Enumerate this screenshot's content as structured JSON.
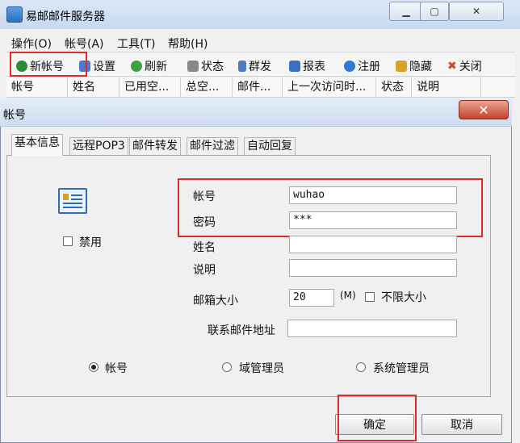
{
  "app": {
    "title": "易邮邮件服务器"
  },
  "menu": [
    "操作(O)",
    "帐号(A)",
    "工具(T)",
    "帮助(H)"
  ],
  "toolbar": [
    {
      "label": "新帐号",
      "icon": "new-account-icon",
      "color": "#2c8a3c"
    },
    {
      "label": "设置",
      "icon": "settings-icon",
      "color": "#4a7bd0"
    },
    {
      "label": "刷新",
      "icon": "refresh-icon",
      "color": "#3fa043"
    },
    {
      "label": "状态",
      "icon": "status-icon",
      "color": "#777777"
    },
    {
      "label": "群发",
      "icon": "broadcast-icon",
      "color": "#4d7ac0"
    },
    {
      "label": "报表",
      "icon": "report-icon",
      "color": "#3a6fc1"
    },
    {
      "label": "注册",
      "icon": "info-icon",
      "color": "#2e78d6"
    },
    {
      "label": "隐藏",
      "icon": "hide-icon",
      "color": "#d9a12a"
    },
    {
      "label": "关闭",
      "icon": "close-icon",
      "color": "#d6452c"
    }
  ],
  "columns": [
    "帐号",
    "姓名",
    "已用空...",
    "总空...",
    "邮件...",
    "上一次访问时...",
    "状态",
    "说明"
  ],
  "dialog": {
    "title": "帐号",
    "tabs": [
      "基本信息",
      "远程POP3",
      "邮件转发",
      "邮件过滤",
      "自动回复"
    ],
    "disable_label": "禁用",
    "fields": {
      "account": {
        "label": "帐号",
        "value": "wuhao"
      },
      "password": {
        "label": "密码",
        "value": "***"
      },
      "name": {
        "label": "姓名",
        "value": ""
      },
      "desc": {
        "label": "说明",
        "value": ""
      },
      "mailbox_size": {
        "label": "邮箱大小",
        "value": "20",
        "unit": "(M)"
      },
      "unlimited": {
        "label": "不限大小"
      },
      "contact": {
        "label": "联系邮件地址",
        "value": ""
      }
    },
    "roles": [
      {
        "label": "帐号",
        "selected": true
      },
      {
        "label": "域管理员",
        "selected": false
      },
      {
        "label": "系统管理员",
        "selected": false
      }
    ],
    "ok_label": "确定",
    "cancel_label": "取消"
  },
  "colors": {
    "highlight": "#e02a2a",
    "titlebar": "#cfdcee"
  }
}
